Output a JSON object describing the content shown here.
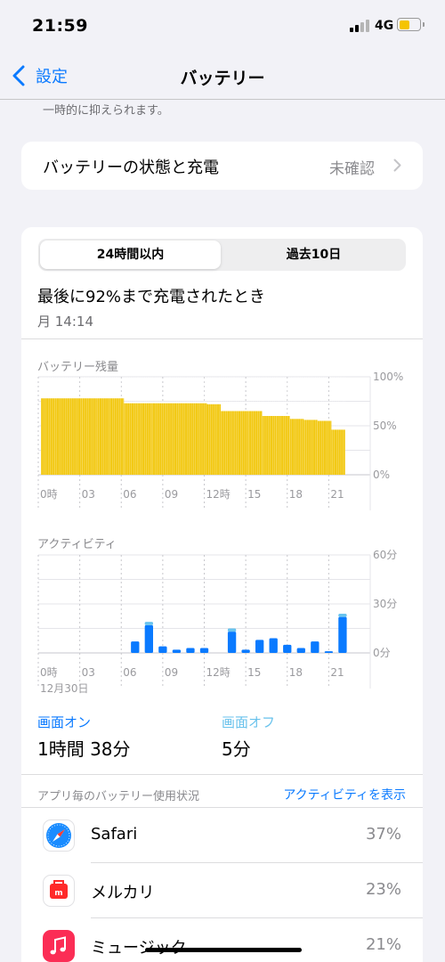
{
  "status_bar": {
    "time": "21:59",
    "network": "4G",
    "battery_level": 0.55,
    "signal_bars_active": 2
  },
  "nav": {
    "back_label": "設定",
    "title": "バッテリー"
  },
  "note": "一時的に抑えられます。",
  "health": {
    "label": "バッテリーの状態と充電",
    "value": "未確認"
  },
  "segments": {
    "active": "24時間以内",
    "inactive": "過去10日"
  },
  "last_charge": {
    "title": "最後に92%まで充電されたとき",
    "time": "月 14:14"
  },
  "battery_chart_title": "バッテリー残量",
  "activity_chart_title": "アクティビティ",
  "chart_date": "12月30日",
  "screen": {
    "on_label": "画面オン",
    "on_value": "1時間 38分",
    "off_label": "画面オフ",
    "off_value": "5分"
  },
  "apps_header": "アプリ毎のバッテリー使用状況",
  "apps_link": "アクティビティを表示",
  "apps": [
    {
      "name": "Safari",
      "percent": "37%",
      "icon": "safari-icon",
      "color": "#1a8cff"
    },
    {
      "name": "メルカリ",
      "percent": "23%",
      "icon": "mercari-icon",
      "color": "#ff2a2a"
    },
    {
      "name": "ミュージック",
      "percent": "21%",
      "icon": "music-icon",
      "color": "#fb2d55"
    }
  ],
  "colors": {
    "accent": "#0a7aff",
    "battery_bar": "#f2c811",
    "activity_on": "#0a7aff",
    "activity_off": "#6ac4ee"
  },
  "chart_data": [
    {
      "type": "bar",
      "title": "バッテリー残量",
      "x_tick_labels": [
        "0時",
        "03",
        "06",
        "09",
        "12時",
        "15",
        "18",
        "21"
      ],
      "y_tick_labels": [
        "100%",
        "50%",
        "0%"
      ],
      "ylim": [
        0,
        100
      ],
      "x_hours": [
        0,
        1,
        2,
        3,
        4,
        5,
        6,
        7,
        8,
        9,
        10,
        11,
        12,
        13,
        14,
        15,
        16,
        17,
        18,
        19,
        20,
        21
      ],
      "values": [
        78,
        78,
        78,
        78,
        78,
        78,
        73,
        73,
        73,
        73,
        73,
        73,
        72,
        65,
        65,
        65,
        60,
        60,
        57,
        56,
        55,
        46
      ]
    },
    {
      "type": "bar",
      "title": "アクティビティ",
      "x_tick_labels": [
        "0時",
        "03",
        "06",
        "09",
        "12時",
        "15",
        "18",
        "21"
      ],
      "y_tick_labels": [
        "60分",
        "30分",
        "0分"
      ],
      "ylim": [
        0,
        60
      ],
      "x_hours": [
        6,
        7,
        8,
        9,
        10,
        11,
        13,
        14,
        15,
        16,
        17,
        18,
        19,
        20,
        21
      ],
      "series": [
        {
          "name": "画面オン",
          "values": [
            7,
            17,
            4,
            2,
            3,
            3,
            13,
            2,
            8,
            9,
            5,
            3,
            7,
            1,
            22
          ]
        },
        {
          "name": "画面オフ",
          "values": [
            0,
            2,
            0,
            0,
            0,
            0,
            2,
            0,
            0,
            0,
            0,
            0,
            0,
            0,
            2
          ]
        }
      ]
    }
  ]
}
